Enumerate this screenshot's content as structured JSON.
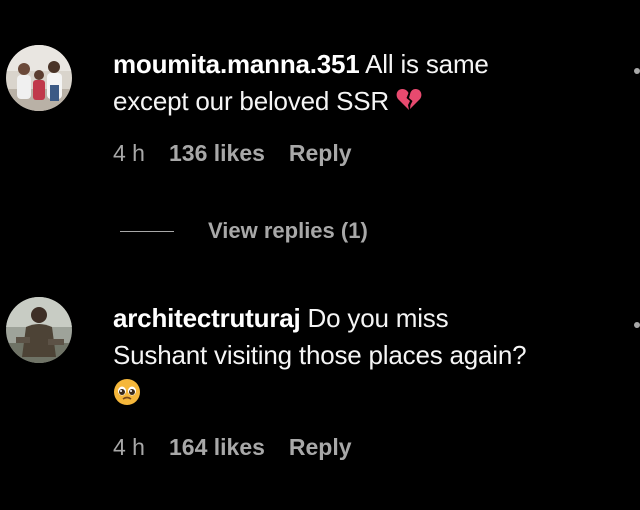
{
  "comments": [
    {
      "username": "moumita.manna.351",
      "text_line1": " All is same",
      "text_line2": "except our beloved SSR",
      "emoji": "broken-heart-icon",
      "time": "4 h",
      "likes": "136 likes",
      "reply_label": "Reply"
    },
    {
      "username": "architectruturaj",
      "text_line1": " Do you miss",
      "text_line2": "Sushant visiting those places again?",
      "emoji": "pleading-face-icon",
      "time": "4 h",
      "likes": "164 likes",
      "reply_label": "Reply"
    }
  ],
  "view_replies": {
    "label": "View replies (1)"
  },
  "colors": {
    "background": "#000000",
    "text": "#f5f5f5",
    "secondary": "#a8a8a8",
    "broken_heart": "#e84a6f",
    "emoji_face": "#f5b73b"
  }
}
